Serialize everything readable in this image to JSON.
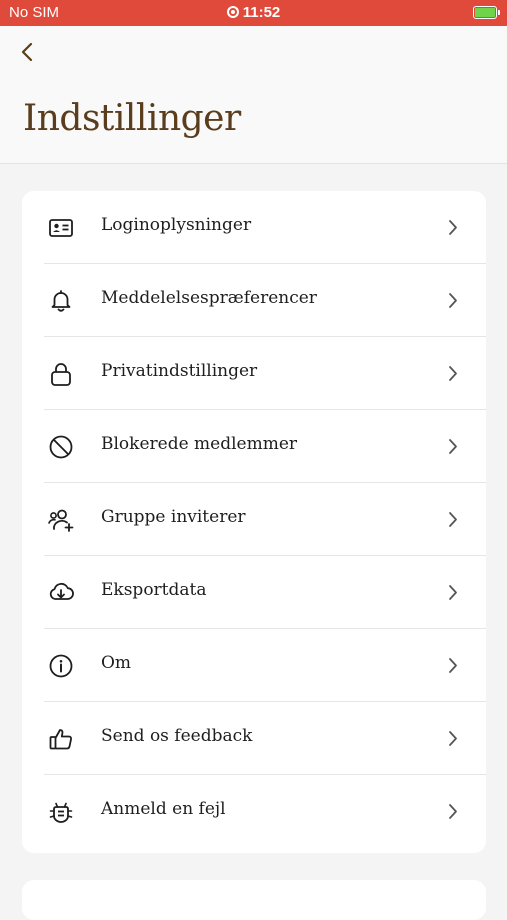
{
  "status_bar": {
    "carrier": "No SIM",
    "time": "11:52",
    "icons": [
      "record-icon",
      "battery-charging-icon"
    ],
    "background_color": "#e04a3a"
  },
  "header": {
    "title": "Indstillinger",
    "back_icon": "chevron-left-icon",
    "title_color": "#5a3d1c"
  },
  "settings": {
    "items": [
      {
        "label": "Loginoplysninger",
        "icon": "id-card-icon"
      },
      {
        "label": "Meddelelsespræferencer",
        "icon": "bell-icon"
      },
      {
        "label": "Privatindstillinger",
        "icon": "lock-icon"
      },
      {
        "label": "Blokerede medlemmer",
        "icon": "block-icon"
      },
      {
        "label": "Gruppe inviterer",
        "icon": "user-plus-icon"
      },
      {
        "label": "Eksportdata",
        "icon": "cloud-download-icon"
      },
      {
        "label": "Om",
        "icon": "info-icon"
      },
      {
        "label": "Send os feedback",
        "icon": "thumbs-up-icon"
      },
      {
        "label": "Anmeld en fejl",
        "icon": "bug-icon"
      }
    ],
    "row_icon": "chevron-right-icon"
  }
}
